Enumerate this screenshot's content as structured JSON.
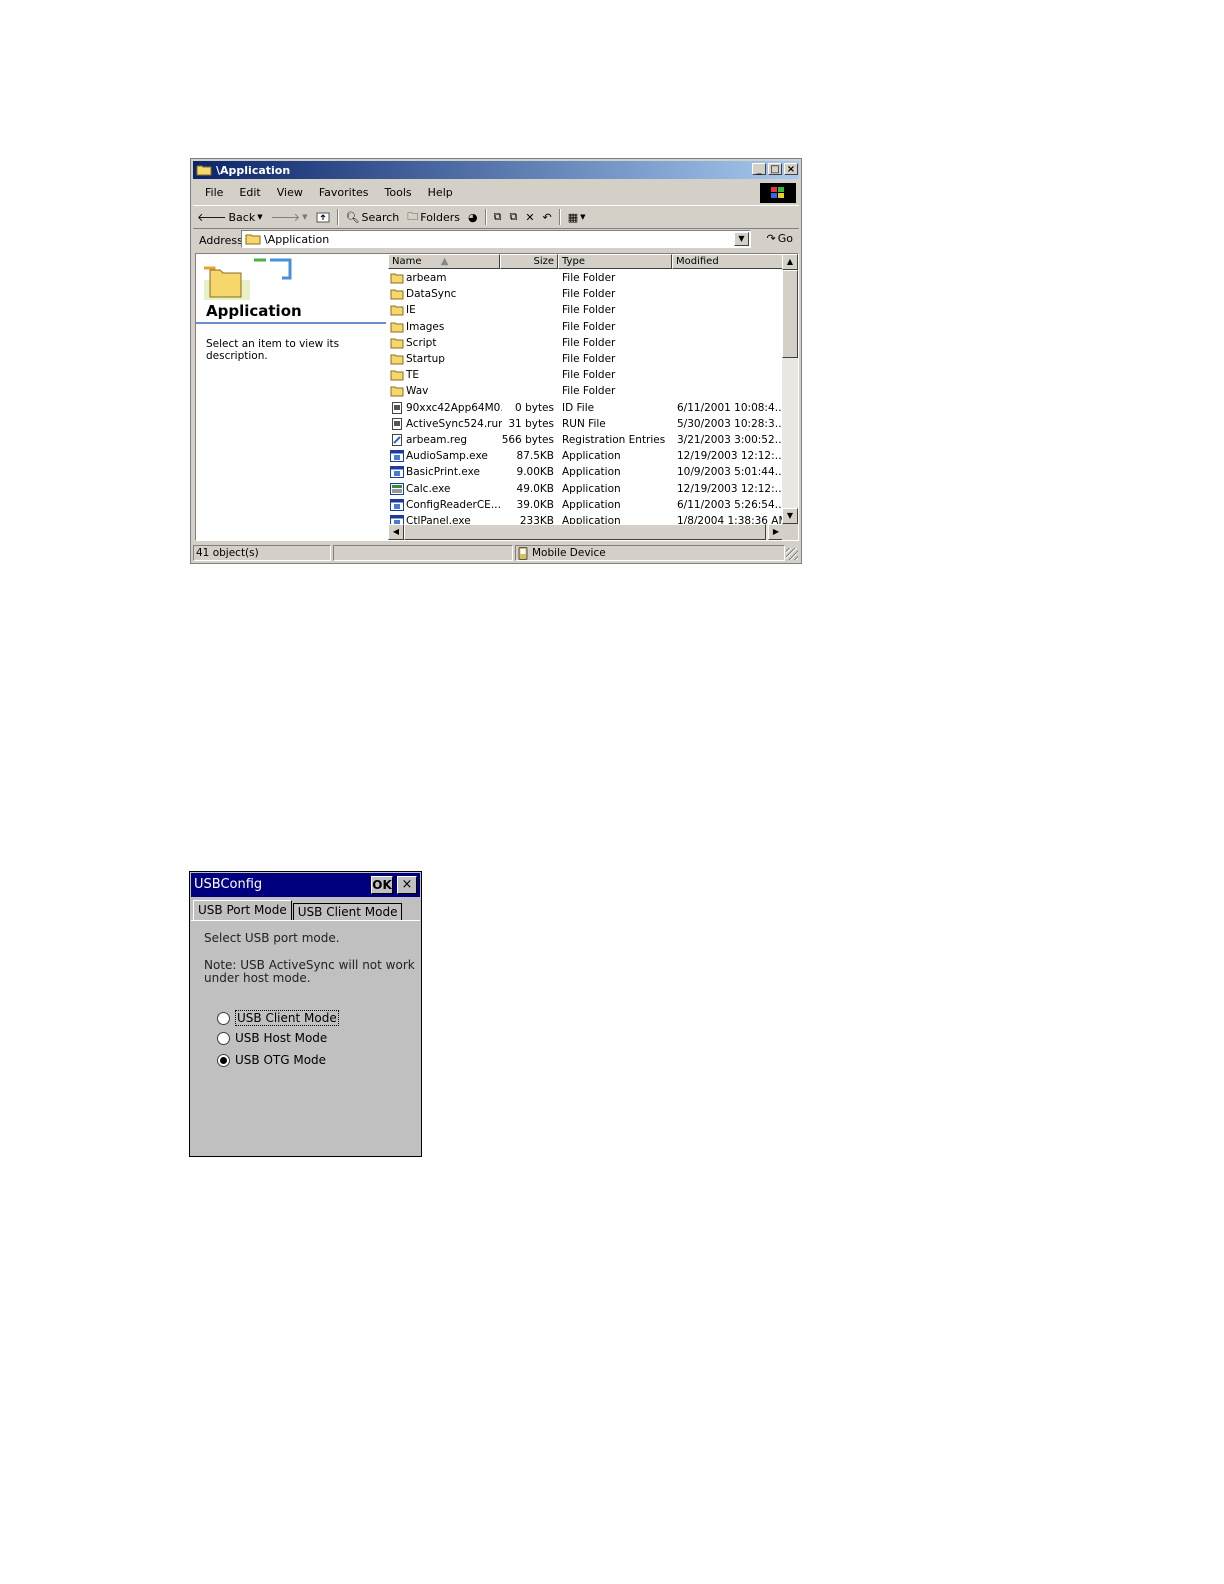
{
  "explorer": {
    "title": "\\Application",
    "menu": [
      "File",
      "Edit",
      "View",
      "Favorites",
      "Tools",
      "Help"
    ],
    "toolbar": {
      "back": "Back",
      "search": "Search",
      "folders": "Folders"
    },
    "address": {
      "label": "Address",
      "value": "\\Application",
      "go": "Go"
    },
    "left_pane": {
      "title": "Application",
      "description": "Select an item to view its description."
    },
    "columns": [
      "Name",
      "Size",
      "Type",
      "Modified"
    ],
    "files": [
      {
        "name": "arbeam",
        "size": "",
        "type": "File Folder",
        "modified": "",
        "icon": "folder-icon"
      },
      {
        "name": "DataSync",
        "size": "",
        "type": "File Folder",
        "modified": "",
        "icon": "folder-icon"
      },
      {
        "name": "IE",
        "size": "",
        "type": "File Folder",
        "modified": "",
        "icon": "folder-icon"
      },
      {
        "name": "Images",
        "size": "",
        "type": "File Folder",
        "modified": "",
        "icon": "folder-icon"
      },
      {
        "name": "Script",
        "size": "",
        "type": "File Folder",
        "modified": "",
        "icon": "folder-icon"
      },
      {
        "name": "Startup",
        "size": "",
        "type": "File Folder",
        "modified": "",
        "icon": "folder-icon"
      },
      {
        "name": "TE",
        "size": "",
        "type": "File Folder",
        "modified": "",
        "icon": "folder-icon"
      },
      {
        "name": "Wav",
        "size": "",
        "type": "File Folder",
        "modified": "",
        "icon": "folder-icon"
      },
      {
        "name": "90xxc42App64M0…",
        "size": "0 bytes",
        "type": "ID File",
        "modified": "6/11/2001  10:08:4…",
        "icon": "file-icon"
      },
      {
        "name": "ActiveSync524.run",
        "size": "31 bytes",
        "type": "RUN File",
        "modified": "5/30/2003  10:28:3…",
        "icon": "file-icon"
      },
      {
        "name": "arbeam.reg",
        "size": "566 bytes",
        "type": "Registration Entries",
        "modified": "3/21/2003  3:00:52…",
        "icon": "registry-icon"
      },
      {
        "name": "AudioSamp.exe",
        "size": "87.5KB",
        "type": "Application",
        "modified": "12/19/2003  12:12:…",
        "icon": "app-icon"
      },
      {
        "name": "BasicPrint.exe",
        "size": "9.00KB",
        "type": "Application",
        "modified": "10/9/2003  5:01:44…",
        "icon": "app-icon"
      },
      {
        "name": "Calc.exe",
        "size": "49.0KB",
        "type": "Application",
        "modified": "12/19/2003  12:12:…",
        "icon": "calculator-icon"
      },
      {
        "name": "ConfigReaderCE.…",
        "size": "39.0KB",
        "type": "Application",
        "modified": "6/11/2003  5:26:54…",
        "icon": "app-icon"
      },
      {
        "name": "CtlPanel.exe",
        "size": "233KB",
        "type": "Application",
        "modified": "1/8/2004  1:38:36 AM",
        "icon": "app-icon"
      }
    ],
    "status": {
      "objects": "41 object(s)",
      "location": "Mobile Device"
    }
  },
  "usbconfig": {
    "title": "USBConfig",
    "ok": "OK",
    "close": "×",
    "tabs": [
      "USB Port Mode",
      "USB Client Mode"
    ],
    "instruction": "Select USB port mode.",
    "note_line1": "Note: USB ActiveSync will not work",
    "note_line2": "under host mode.",
    "options": [
      {
        "label": "USB Client Mode",
        "checked": false
      },
      {
        "label": "USB Host Mode",
        "checked": false
      },
      {
        "label": "USB OTG Mode",
        "checked": true
      }
    ]
  }
}
